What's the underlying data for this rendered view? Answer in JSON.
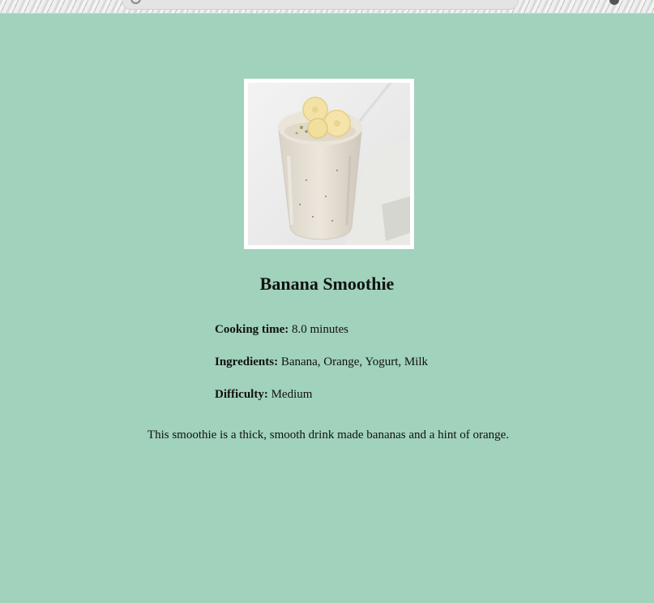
{
  "recipe": {
    "title": "Banana Smoothie",
    "image_alt": "Banana Smoothie",
    "cooking_time_label": "Cooking time:",
    "cooking_time_value": "8.0 minutes",
    "ingredients_label": "Ingredients:",
    "ingredients_value": "Banana, Orange, Yogurt, Milk",
    "difficulty_label": "Difficulty:",
    "difficulty_value": "Medium",
    "description": "This smoothie is a thick, smooth drink made bananas and a hint of orange."
  },
  "colors": {
    "page_background": "#a0d2bc",
    "frame": "#ffffff"
  }
}
